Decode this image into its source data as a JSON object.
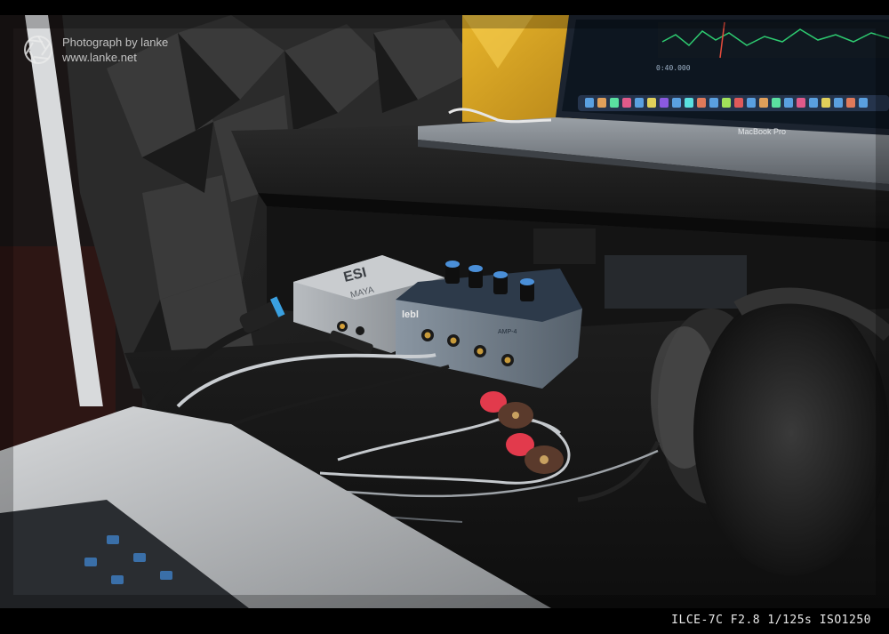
{
  "watermark": {
    "line1": "Photograph by lanke",
    "line2": "www.lanke.net",
    "icon": "aperture-icon"
  },
  "photo": {
    "laptop_label": "MacBook Pro",
    "esi_logo": "ESI",
    "esi_model": "MAYA",
    "amp_brand": "lebl",
    "amp_model": "AMP-4",
    "screen_timecode": "0:40.000"
  },
  "exif": {
    "text": "ILCE-7C F2.8 1/125s ISO1250"
  }
}
